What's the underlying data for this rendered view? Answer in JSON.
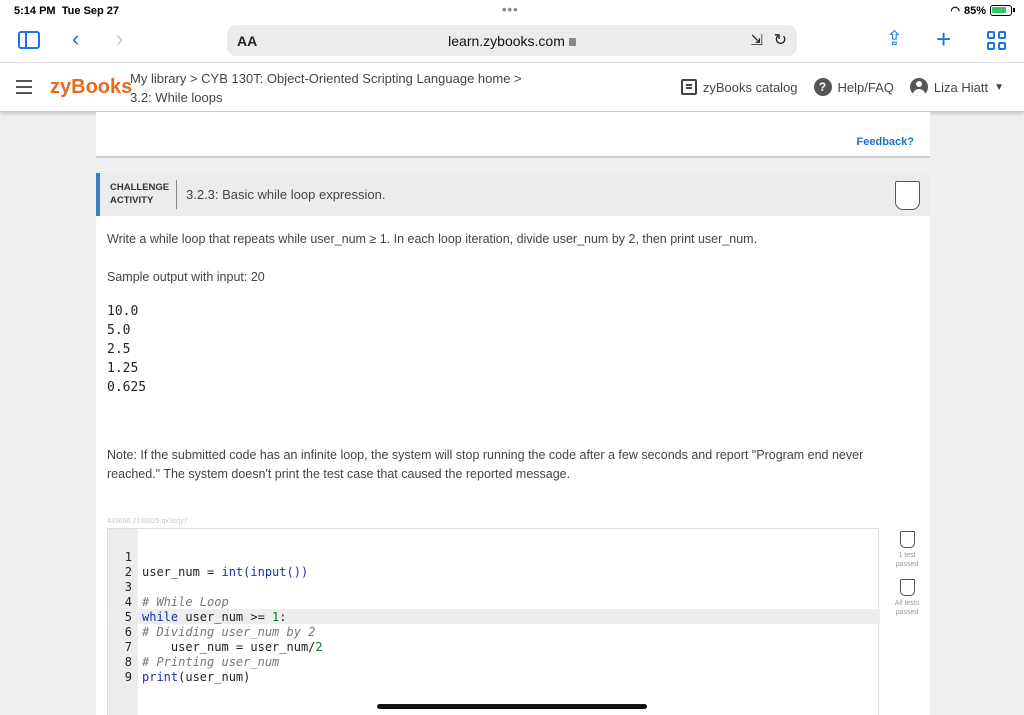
{
  "status": {
    "time": "5:14 PM",
    "date": "Tue Sep 27",
    "battery": "85%"
  },
  "browser": {
    "aa_label": "AA",
    "url": "learn.zybooks.com"
  },
  "header": {
    "logo": "zyBooks",
    "breadcrumb_line1": "My library > CYB 130T: Object-Oriented Scripting Language home >",
    "breadcrumb_line2": "3.2: While loops",
    "catalog": "zyBooks catalog",
    "help": "Help/FAQ",
    "user": "Liza Hiatt"
  },
  "prev_card": {
    "feedback": "Feedback?"
  },
  "challenge": {
    "label_line1": "CHALLENGE",
    "label_line2": "ACTIVITY",
    "title": "3.2.3: Basic while loop expression.",
    "prompt": "Write a while loop that repeats while user_num ≥ 1. In each loop iteration, divide user_num by 2, then print user_num.",
    "sample_label": "Sample output with input: 20",
    "sample_output": [
      "10.0",
      "5.0",
      "2.5",
      "1.25",
      "0.625"
    ],
    "note": "Note: If the submitted code has an infinite loop, the system will stop running the code after a few seconds and report \"Program end never reached.\" The system doesn't print the test case that caused the reported message.",
    "code_id": "433686.2138825.qx3zqy7",
    "tests": [
      {
        "label": "1 test passed"
      },
      {
        "label": "All tests passed"
      }
    ]
  },
  "code": {
    "line_numbers": [
      "1",
      "2",
      "3",
      "4",
      "5",
      "6",
      "7",
      "8",
      "9"
    ],
    "l1_var": "user_num = ",
    "l1_fn": "int(input())",
    "l3": "# While Loop",
    "l4_kw": "while",
    "l4_rest": " user_num >= ",
    "l4_num": "1",
    "l4_colon": ":",
    "l5": "# Dividing user_num by 2",
    "l6_rest": "    user_num = user_num/",
    "l6_num": "2",
    "l7": "# Printing user_num",
    "l8_fn": "print",
    "l8_rest": "(user_num)"
  }
}
